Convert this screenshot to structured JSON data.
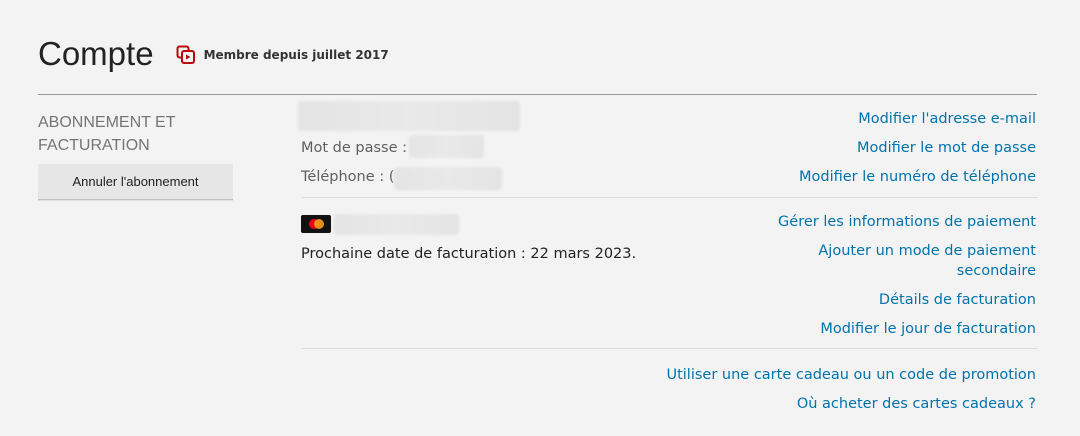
{
  "header": {
    "title": "Compte",
    "member_since": "Membre depuis juillet 2017",
    "icon": "member-badge-icon",
    "accent_color": "#b9090b"
  },
  "membership": {
    "heading": "ABONNEMENT ET FACTURATION",
    "cancel_button": "Annuler l'abonnement",
    "password_label": "Mot de passe :",
    "phone_label": "Téléphone : (",
    "next_billing": "Prochaine date de facturation : 22 mars 2023.",
    "card_icon": "mastercard-icon",
    "links": {
      "change_email": "Modifier l'adresse e-mail",
      "change_password": "Modifier le mot de passe",
      "change_phone": "Modifier le numéro de téléphone",
      "manage_payment": "Gérer les informations de paiement",
      "add_backup_payment": "Ajouter un mode de paiement secondaire",
      "billing_details": "Détails de facturation",
      "change_billing_day": "Modifier le jour de facturation",
      "redeem_gift": "Utiliser une carte cadeau ou un code de promotion",
      "where_buy_gift": "Où acheter des cartes cadeaux ?"
    },
    "link_color": "#0073ad"
  }
}
